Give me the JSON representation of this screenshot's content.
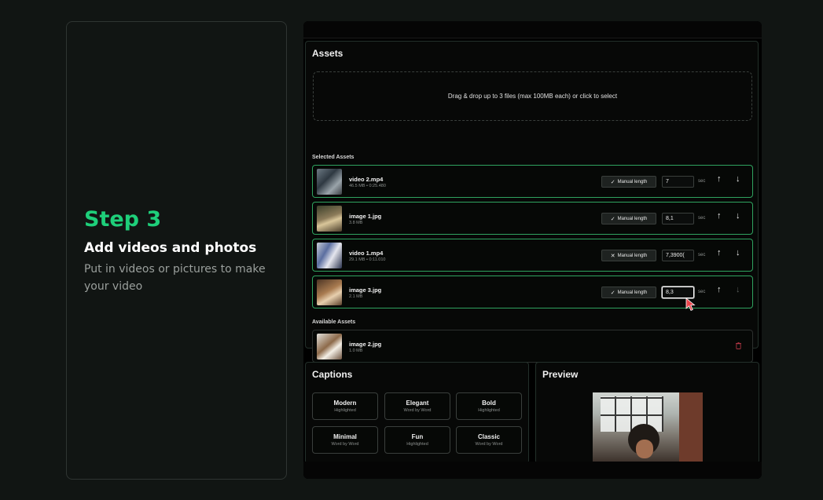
{
  "step": {
    "label": "Step 3",
    "title": "Add videos and photos",
    "description": "Put in videos or pictures to make your video"
  },
  "assets": {
    "title": "Assets",
    "dropzone_text": "Drag & drop up to 3 files (max 100MB each) or click to select",
    "selected_label": "Selected Assets",
    "available_label": "Available Assets",
    "manual_length_label": "Manual length",
    "sec_label": "sec",
    "selected": [
      {
        "name": "video 2.mp4",
        "meta": "46.5 MB • 0:25.480",
        "check_icon": "✓",
        "length": "7"
      },
      {
        "name": "image 1.jpg",
        "meta": "3.8 MB",
        "check_icon": "✓",
        "length": "8,1"
      },
      {
        "name": "video 1.mp4",
        "meta": "29.1 MB • 0:11.010",
        "check_icon": "✕",
        "length": "7,3900("
      },
      {
        "name": "image 3.jpg",
        "meta": "2.1 MB",
        "check_icon": "✓",
        "length": "8,3"
      }
    ],
    "available": [
      {
        "name": "image 2.jpg",
        "meta": "1.0 MB"
      }
    ]
  },
  "captions": {
    "title": "Captions",
    "styles": [
      {
        "name": "Modern",
        "sub": "Highlighted"
      },
      {
        "name": "Elegant",
        "sub": "Word by Word"
      },
      {
        "name": "Bold",
        "sub": "Highlighted"
      },
      {
        "name": "Minimal",
        "sub": "Word by Word"
      },
      {
        "name": "Fun",
        "sub": "Highlighted"
      },
      {
        "name": "Classic",
        "sub": "Word by Word"
      }
    ]
  },
  "preview": {
    "title": "Preview"
  },
  "icons": {
    "arrow_up": "↑",
    "arrow_down": "↓"
  },
  "colors": {
    "accent": "#1ecf7a",
    "row_border": "#2fa35f",
    "trash": "#c23b4a"
  }
}
